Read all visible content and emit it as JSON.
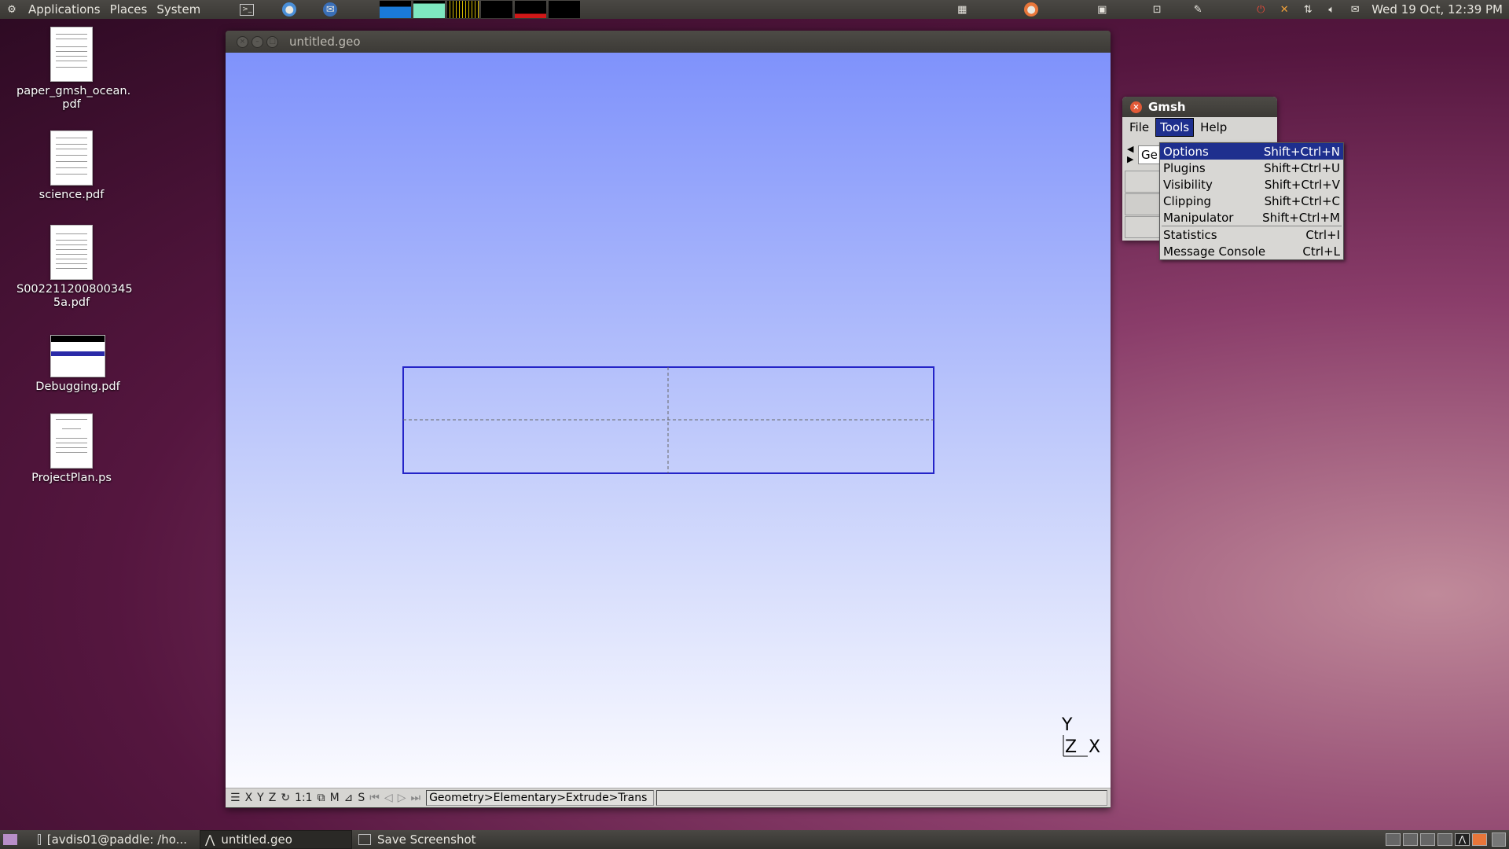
{
  "top_panel": {
    "menus": [
      "Applications",
      "Places",
      "System"
    ],
    "clock": "Wed 19 Oct, 12:39 PM"
  },
  "desktop_icons": [
    {
      "label": "paper_gmsh_ocean.\npdf"
    },
    {
      "label": "science.pdf"
    },
    {
      "label": "S002211200800345\n5a.pdf"
    },
    {
      "label": "Debugging.pdf"
    },
    {
      "label": "ProjectPlan.ps"
    }
  ],
  "main_window": {
    "title": "untitled.geo",
    "axes": {
      "y": "Y",
      "z": "Z",
      "x": "X"
    },
    "status_buttons": [
      "X",
      "Y",
      "Z",
      "1:1",
      "M",
      "S"
    ],
    "status_path": "Geometry>Elementary>Extrude>Trans"
  },
  "gmsh_window": {
    "title": "Gmsh",
    "menu": [
      "File",
      "Tools",
      "Help"
    ],
    "tree_label": "Ge"
  },
  "tools_menu": [
    {
      "label": "Options",
      "shortcut": "Shift+Ctrl+N"
    },
    {
      "label": "Plugins",
      "shortcut": "Shift+Ctrl+U"
    },
    {
      "label": "Visibility",
      "shortcut": "Shift+Ctrl+V"
    },
    {
      "label": "Clipping",
      "shortcut": "Shift+Ctrl+C"
    },
    {
      "label": "Manipulator",
      "shortcut": "Shift+Ctrl+M"
    },
    {
      "label": "Statistics",
      "shortcut": "Ctrl+I"
    },
    {
      "label": "Message Console",
      "shortcut": "Ctrl+L"
    }
  ],
  "taskbar": [
    {
      "label": "[avdis01@paddle: /ho..."
    },
    {
      "label": "untitled.geo"
    },
    {
      "label": "Save Screenshot"
    }
  ],
  "colors": {
    "accent": "#1e2f8e",
    "geometry_line": "#2424c8"
  }
}
